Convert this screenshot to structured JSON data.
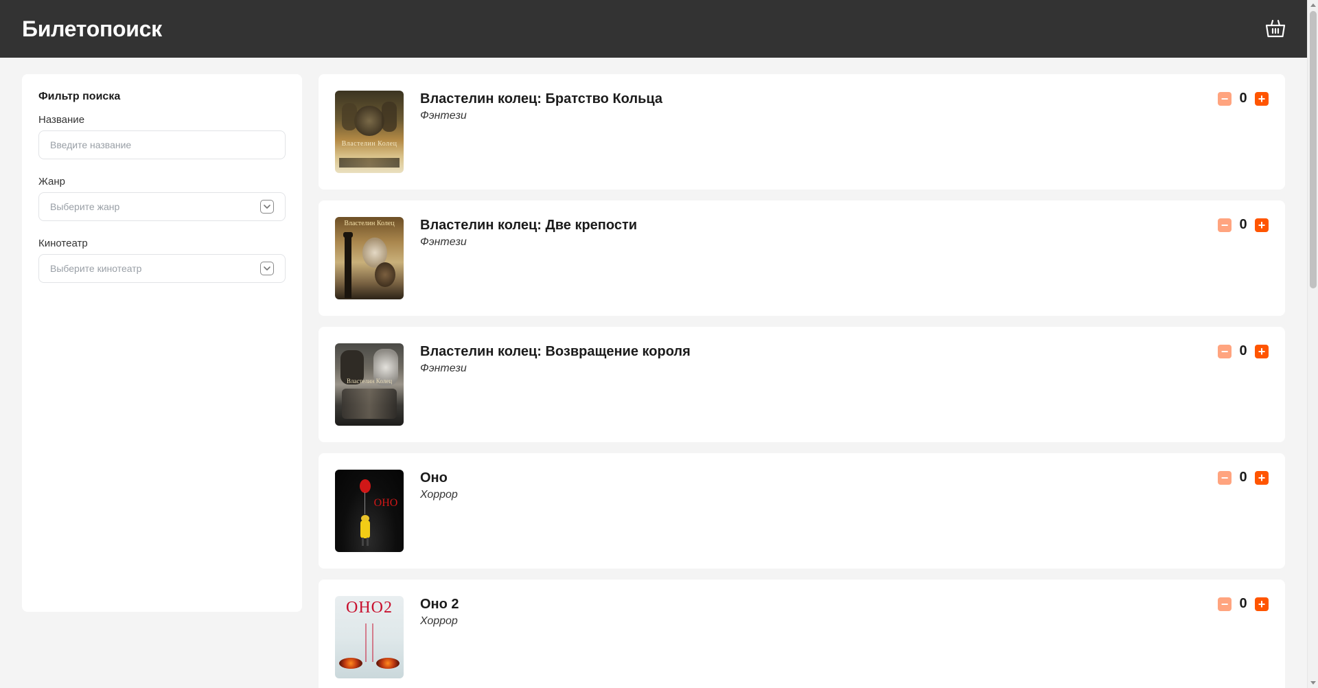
{
  "header": {
    "logo": "Билетопоиск",
    "basket_icon": "basket-icon"
  },
  "filter": {
    "title": "Фильтр поиска",
    "name_label": "Название",
    "name_placeholder": "Введите название",
    "genre_label": "Жанр",
    "genre_placeholder": "Выберите жанр",
    "cinema_label": "Кинотеатр",
    "cinema_placeholder": "Выберите кинотеатр"
  },
  "colors": {
    "header_bg": "#333333",
    "accent": "#ff5500",
    "accent_light": "#ffa47f"
  },
  "movies": [
    {
      "title": "Властелин колец: Братство Кольца",
      "genre": "Фэнтези",
      "count": "0",
      "poster_text": "Властелин Колец"
    },
    {
      "title": "Властелин колец: Две крепости",
      "genre": "Фэнтези",
      "count": "0",
      "poster_text": "Властелин Колец"
    },
    {
      "title": "Властелин колец: Возвращение короля",
      "genre": "Фэнтези",
      "count": "0",
      "poster_text": "Властелин Колец"
    },
    {
      "title": "Оно",
      "genre": "Хоррор",
      "count": "0",
      "poster_text": "ОНО"
    },
    {
      "title": "Оно 2",
      "genre": "Хоррор",
      "count": "0",
      "poster_text": "ОНО2"
    }
  ]
}
